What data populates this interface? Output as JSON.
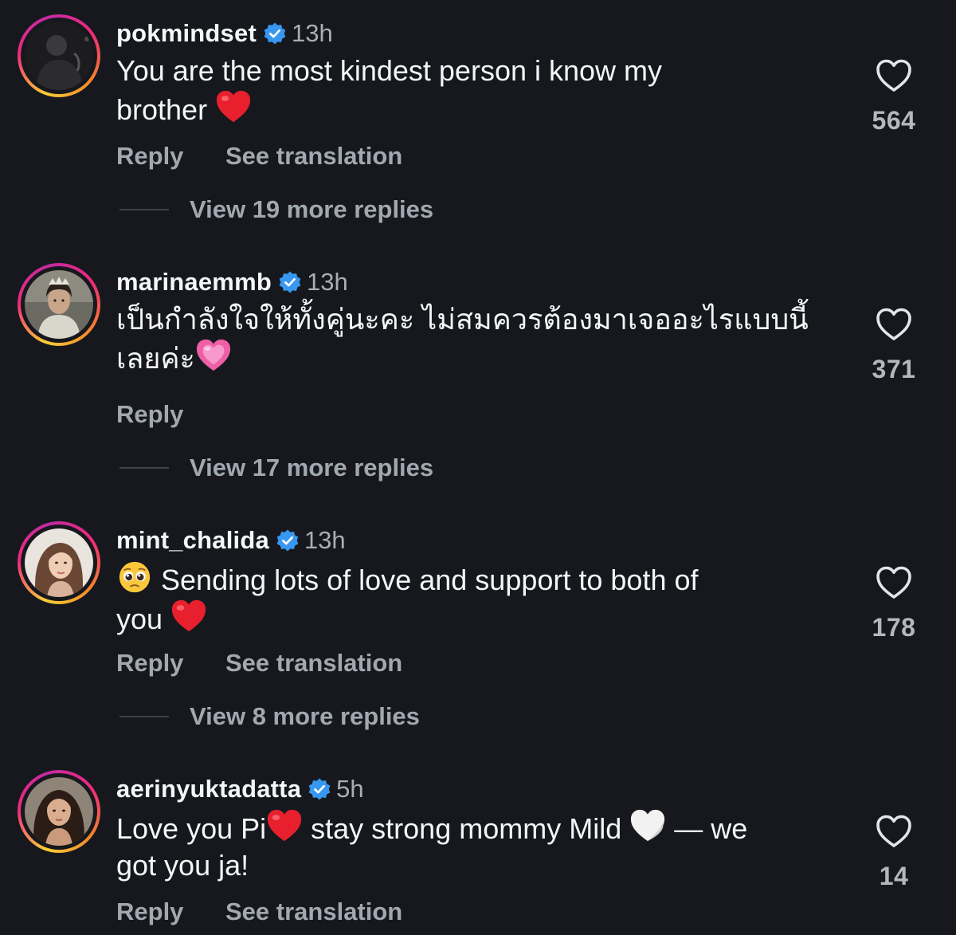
{
  "comments": [
    {
      "username": "pokmindset",
      "time": "13h",
      "line1": "You are the most kindest person i know my",
      "line2": "brother",
      "like_count": "564",
      "reply_label": "Reply",
      "translate_label": "See translation",
      "view_replies": "View 19 more replies"
    },
    {
      "username": "marinaemmb",
      "time": "13h",
      "line1": "เป็นกำลังใจให้ทั้งคู่นะคะ ไม่สมควรต้องมาเจออะไรแบบนี้",
      "line2": "เลยค่ะ",
      "like_count": "371",
      "reply_label": "Reply",
      "view_replies": "View 17 more replies"
    },
    {
      "username": "mint_chalida",
      "time": "13h",
      "line1": "Sending lots of love and support to both of",
      "line2": "you",
      "like_count": "178",
      "reply_label": "Reply",
      "translate_label": "See translation",
      "view_replies": "View 8 more replies"
    },
    {
      "username": "aerinyuktadatta",
      "time": "5h",
      "line1a": "Love you Pi",
      "line1b": "stay strong mommy Mild",
      "line1c": "— we",
      "line2": "got you ja!",
      "like_count": "14",
      "reply_label": "Reply",
      "translate_label": "See translation"
    }
  ],
  "icons": {
    "verified": "verified-badge-icon",
    "like": "heart-outline-icon"
  },
  "colors": {
    "background": "#16181d",
    "verified_blue": "#3897f0",
    "muted_text": "#a2a8b0"
  }
}
